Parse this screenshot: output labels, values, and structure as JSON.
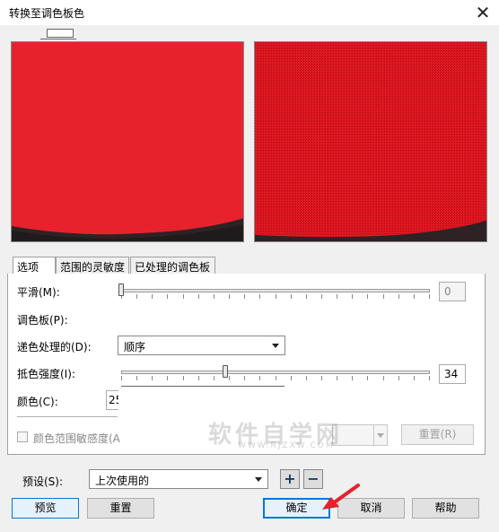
{
  "window": {
    "title": "转换至调色板色",
    "close_glyph": "✕"
  },
  "tabs": [
    {
      "label": "选项",
      "active": true
    },
    {
      "label": "范围的灵敏度",
      "active": false
    },
    {
      "label": "已处理的调色板",
      "active": false
    }
  ],
  "options": {
    "smooth_label": "平滑(M):",
    "smooth_value": "0",
    "palette_label": "调色板(P):",
    "dither_label": "递色处理的(D):",
    "dither_value": "顺序",
    "dither_strength_label": "抵色强度(I):",
    "dither_strength_value": "34",
    "dither_strength_fraction": 0.34,
    "colors_label": "颜色(C):",
    "colors_value": "25",
    "color_range_label": "颜色范围敏感度(A",
    "reset_disabled_label": "重置(R)"
  },
  "preset": {
    "label": "预设(S):",
    "value": "上次使用的",
    "add_glyph": "+",
    "remove_glyph": "−"
  },
  "buttons": {
    "preview": "预览",
    "reset": "重置",
    "ok": "确定",
    "cancel": "取消",
    "help": "帮助"
  },
  "watermark": {
    "text": "软件自学网",
    "url": "WWW.RJZXW.COM"
  },
  "colors": {
    "preview_red": "#e8202a",
    "accent": "#0078d7"
  }
}
